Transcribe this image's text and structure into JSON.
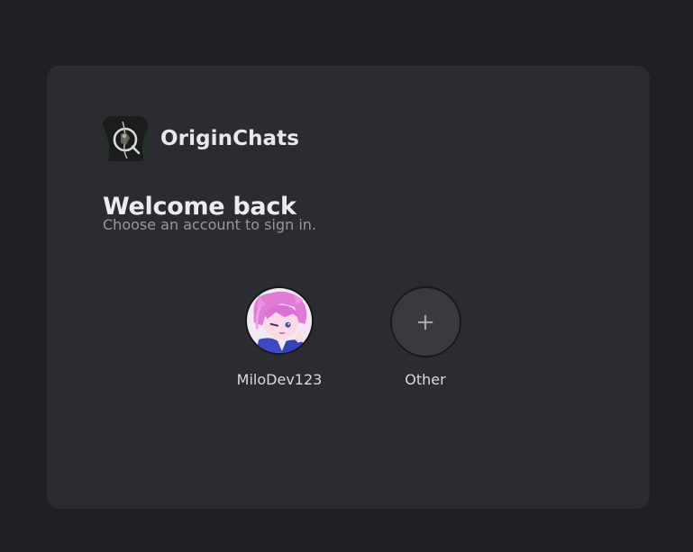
{
  "app": {
    "name": "OriginChats",
    "logo_icon": "origin-chats-logo-icon"
  },
  "login": {
    "title": "Welcome back",
    "subtitle": "Choose an account to sign in."
  },
  "accounts": [
    {
      "username": "MiloDev123",
      "avatar_icon": "anime-avatar-icon"
    }
  ],
  "other_account": {
    "label": "Other",
    "symbol": "+"
  },
  "colors": {
    "page_background": "#1f2024",
    "card_background": "#2b2c31",
    "add_circle_background": "#393a40"
  }
}
